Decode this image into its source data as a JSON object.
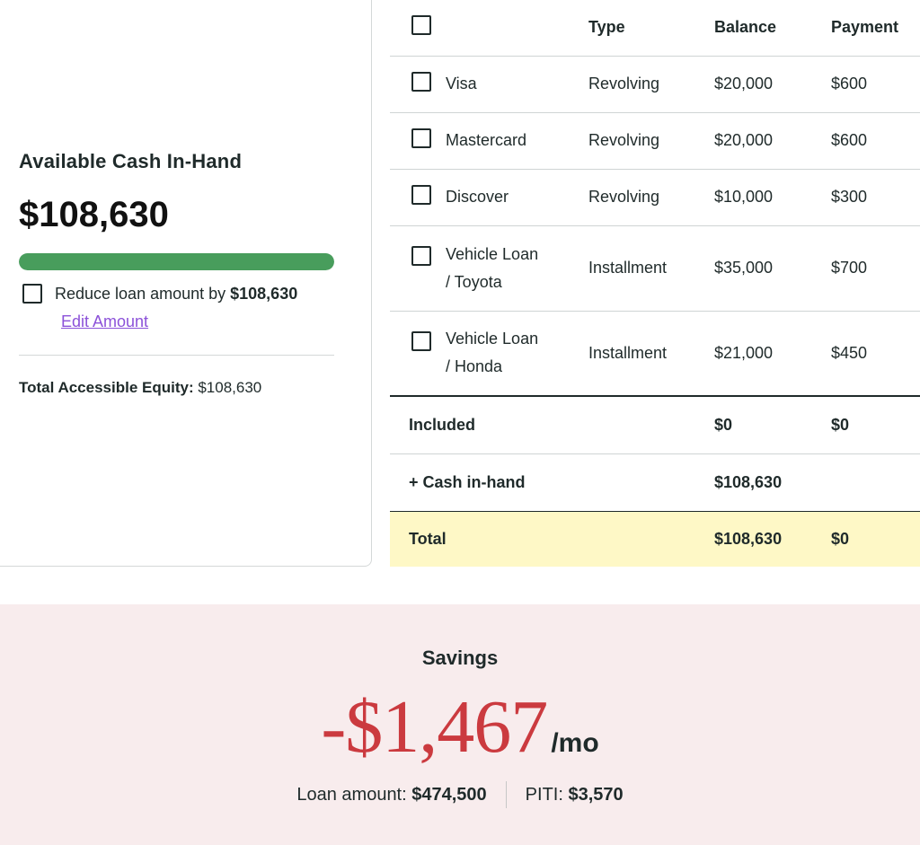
{
  "cash_card": {
    "title": "Available Cash In-Hand",
    "amount": "$108,630",
    "progress_fraction": 1.0,
    "progress_color": "#489d5c",
    "reduce_label": "Reduce loan amount by",
    "reduce_value": "$108,630",
    "reduce_checked": false,
    "edit_link": "Edit Amount",
    "equity_label": "Total Accessible Equity:",
    "equity_value": "$108,630"
  },
  "table": {
    "headers": {
      "type": "Type",
      "balance": "Balance",
      "payment": "Payment"
    },
    "rows": [
      {
        "name": "Visa",
        "type": "Revolving",
        "balance": "$20,000",
        "payment": "$600"
      },
      {
        "name": "Mastercard",
        "type": "Revolving",
        "balance": "$20,000",
        "payment": "$600"
      },
      {
        "name": "Discover",
        "type": "Revolving",
        "balance": "$10,000",
        "payment": "$300"
      },
      {
        "name_line1": "Vehicle Loan",
        "name_line2": "/ Toyota",
        "type": "Installment",
        "balance": "$35,000",
        "payment": "$700"
      },
      {
        "name_line1": "Vehicle Loan",
        "name_line2": "/ Honda",
        "type": "Installment",
        "balance": "$21,000",
        "payment": "$450"
      }
    ],
    "included": {
      "label": "Included",
      "balance": "$0",
      "payment": "$0"
    },
    "cash_in_hand": {
      "label": "+ Cash in-hand",
      "balance": "$108,630"
    },
    "total": {
      "label": "Total",
      "balance": "$108,630",
      "payment": "$0"
    }
  },
  "savings": {
    "label": "Savings",
    "amount": "-$1,467",
    "unit": "/mo",
    "loan_label": "Loan amount:",
    "loan_value": "$474,500",
    "piti_label": "PITI:",
    "piti_value": "$3,570",
    "amount_color": "#cb3a3f",
    "background_color": "#f8eced"
  }
}
